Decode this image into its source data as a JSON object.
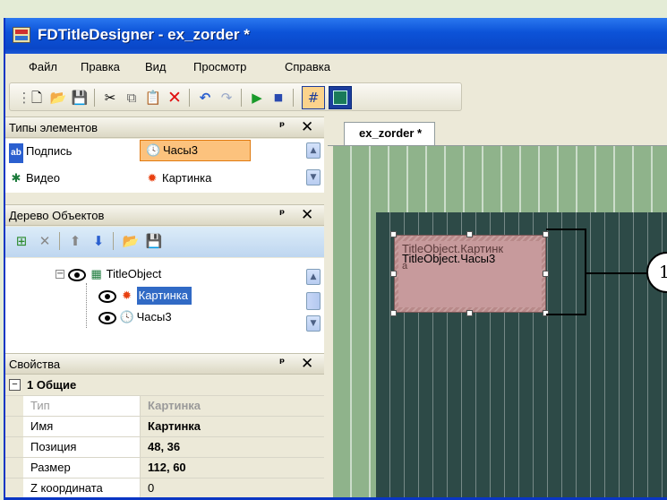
{
  "caption": "",
  "window": {
    "title": "FDTitleDesigner - ex_zorder *"
  },
  "menu": [
    "Файл",
    "Правка",
    "Вид",
    "Просмотр",
    "Справка"
  ],
  "types_panel": {
    "title": "Типы элементов",
    "items": [
      {
        "label": "Подпись",
        "icon": "caption-icon"
      },
      {
        "label": "Часы3",
        "icon": "clock-icon",
        "selected": true
      },
      {
        "label": "Видео",
        "icon": "video-icon"
      },
      {
        "label": "Картинка",
        "icon": "picture-icon"
      }
    ]
  },
  "tree_panel": {
    "title": "Дерево Объектов",
    "root": "TitleObject",
    "children": [
      "Картинка",
      "Часы3"
    ],
    "selected": "Картинка"
  },
  "props_panel": {
    "title": "Свойства",
    "group": "1 Общие",
    "rows": [
      {
        "name": "Тип",
        "value": "Картинка",
        "muted": true
      },
      {
        "name": "Имя",
        "value": "Картинка"
      },
      {
        "name": "Позиция",
        "value": "48, 36"
      },
      {
        "name": "Размер",
        "value": "112, 60"
      },
      {
        "name": "Z координата",
        "value": "0"
      }
    ]
  },
  "designer": {
    "tab": "ex_zorder *",
    "object_labels": [
      "TitleObject.Картинк",
      "а",
      "TitleObject.Часы3"
    ],
    "callout": "1"
  },
  "colors": {
    "titlebar": "#0a47c8",
    "selection": "#316ac5",
    "canvas_border": "#8fb38b",
    "video_area": "#2d4a47",
    "object_fill": "#c79a9c"
  }
}
